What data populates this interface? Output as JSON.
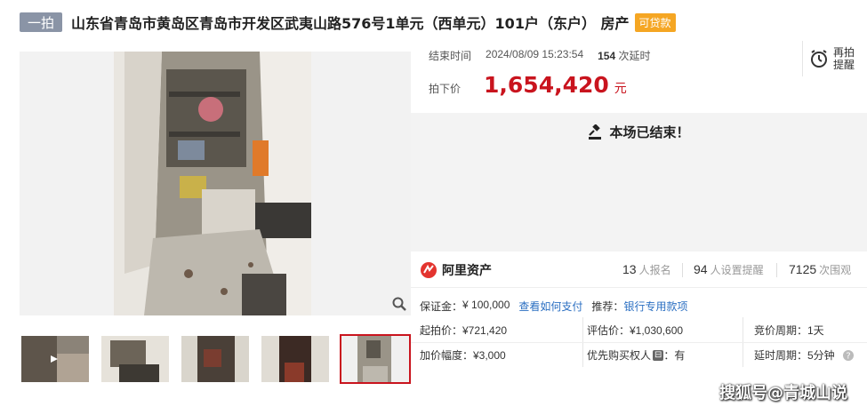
{
  "header": {
    "round_badge": "一拍",
    "title": "山东省青岛市黄岛区青岛市开发区武夷山路576号1单元（西单元）101户（东户） 房产",
    "loan_badge": "可贷款"
  },
  "auction": {
    "end_time_label": "结束时间",
    "end_time": "2024/08/09 15:23:54",
    "delay_count": "154",
    "delay_label": "次延时",
    "final_price_label": "拍下价",
    "final_price": "1,654,420",
    "currency_unit": "元",
    "rebid_label": "再拍提醒",
    "ended_message": "本场已结束！"
  },
  "stats": {
    "platform": "阿里资产",
    "signups": "13",
    "signups_label": "人报名",
    "reminders": "94",
    "reminders_label": "人设置提醒",
    "views": "7125",
    "views_label": "次围观"
  },
  "deposit": {
    "label": "保证金：",
    "value": "¥ 100,000",
    "how_to_pay": "查看如何支付",
    "recommend_label": "推荐：",
    "recommend_link": "银行专用款项"
  },
  "details": {
    "start_price": "起拍价：¥721,420",
    "appraisal": "评估价：¥1,030,600",
    "bid_period": "竞价周期：1天",
    "increment": "加价幅度：¥3,000",
    "priority_label": "优先购买权人",
    "priority_value": "：有",
    "delay_period": "延时周期：5分钟"
  },
  "watermark": "搜狐号@青城山说",
  "colors": {
    "accent_red": "#c9141e",
    "loan_orange": "#f5a623",
    "link_blue": "#2b6fc2",
    "badge_gray": "#8a94a6"
  }
}
